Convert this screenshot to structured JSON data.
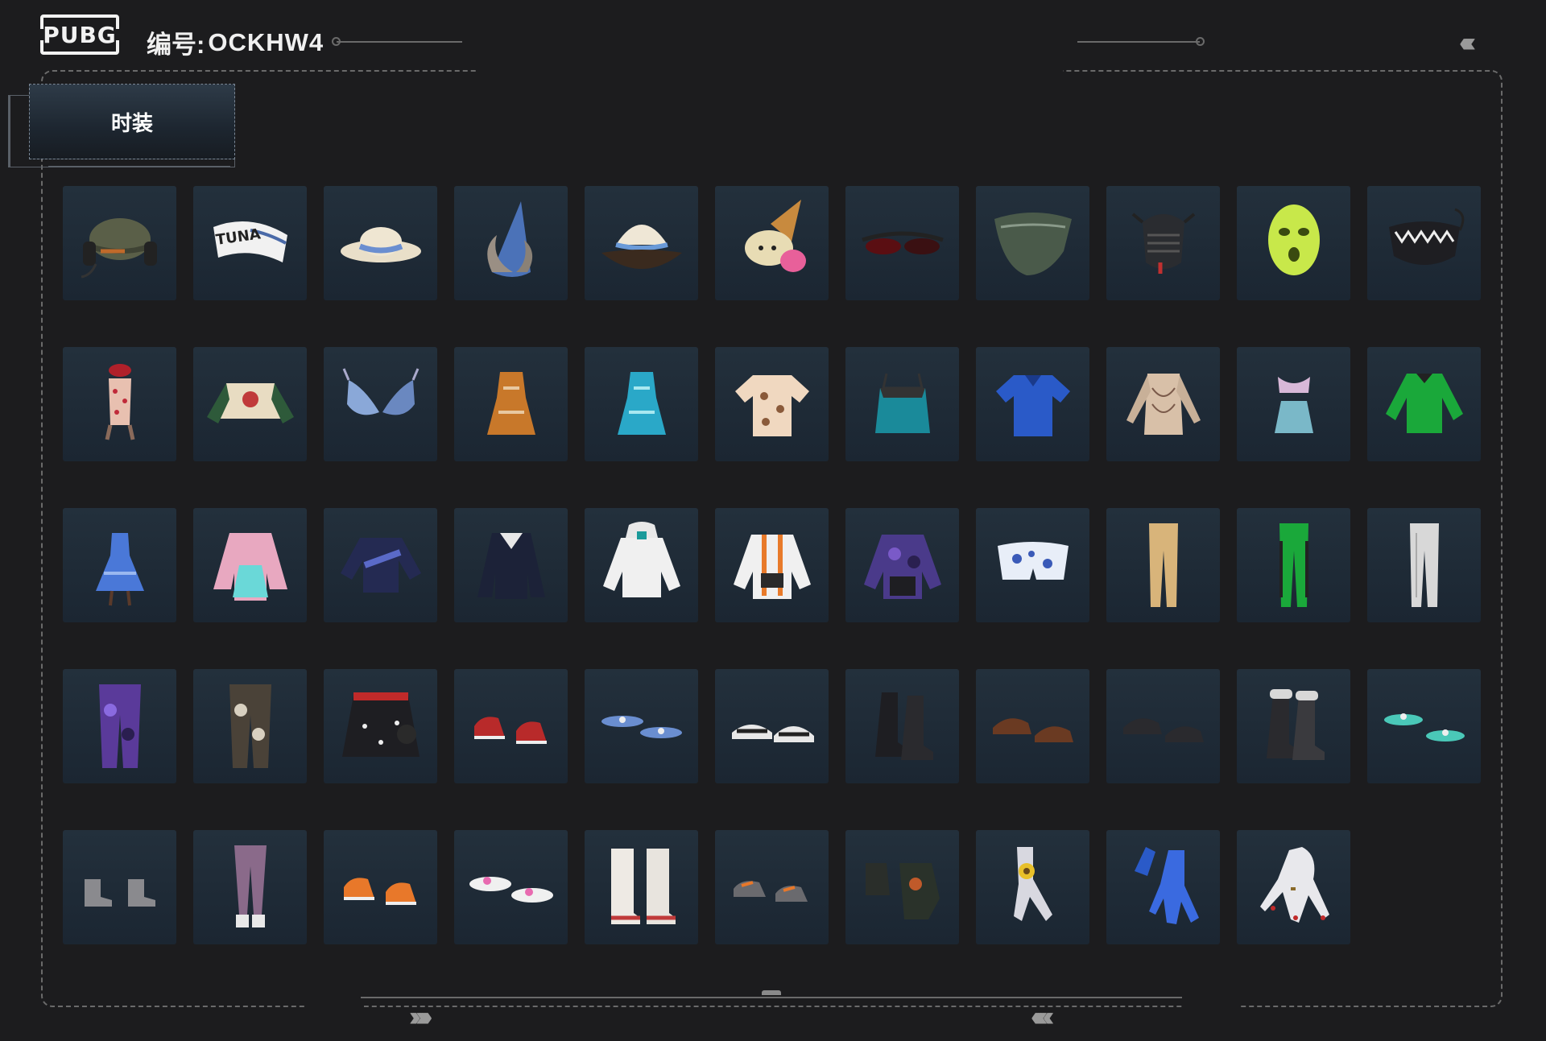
{
  "header": {
    "logo_text": "PUBG",
    "account_label": "编号:",
    "account_id": "OCKHW4"
  },
  "tabs": [
    {
      "label": "时装",
      "selected": true
    }
  ],
  "items": [
    {
      "icon": "headset-cap-icon",
      "name": "Cap with headset"
    },
    {
      "icon": "tuna-headband-icon",
      "name": "TUNA"
    },
    {
      "icon": "sun-hat-icon",
      "name": "Sun hat"
    },
    {
      "icon": "party-hat-icon",
      "name": "Party hat"
    },
    {
      "icon": "bucket-hat-icon",
      "name": "Bucket hat"
    },
    {
      "icon": "ice-cream-hat-icon",
      "name": "Ice cream hat"
    },
    {
      "icon": "sunglasses-icon",
      "name": "Sunglasses"
    },
    {
      "icon": "bandana-mask-icon",
      "name": "Bandana mask"
    },
    {
      "icon": "tactical-mask-icon",
      "name": "Tactical mask"
    },
    {
      "icon": "balaclava-icon",
      "name": "Balaclava"
    },
    {
      "icon": "shark-mask-icon",
      "name": "Shark mask"
    },
    {
      "icon": "floral-swimsuit-icon",
      "name": "Swimsuit"
    },
    {
      "icon": "crop-sweater-icon",
      "name": "Crop sweater"
    },
    {
      "icon": "bikini-top-icon",
      "name": "Bikini top"
    },
    {
      "icon": "orange-dress-icon",
      "name": "Orange dress"
    },
    {
      "icon": "cyan-dress-icon",
      "name": "Cyan dress"
    },
    {
      "icon": "dog-shirt-icon",
      "name": "Printed shirt"
    },
    {
      "icon": "lace-camisole-icon",
      "name": "Camisole"
    },
    {
      "icon": "security-polo-icon",
      "name": "Security polo"
    },
    {
      "icon": "tattoo-top-icon",
      "name": "Tattoo top"
    },
    {
      "icon": "mermaid-outfit-icon",
      "name": "Mermaid outfit"
    },
    {
      "icon": "green-jersey-icon",
      "name": "Green jersey"
    },
    {
      "icon": "blue-gradient-dress-icon",
      "name": "Blue dress"
    },
    {
      "icon": "pink-fur-jacket-icon",
      "name": "Pink fur jacket"
    },
    {
      "icon": "navy-sweatshirt-icon",
      "name": "Navy sweatshirt"
    },
    {
      "icon": "navy-coat-icon",
      "name": "Navy coat"
    },
    {
      "icon": "white-hoodie-icon",
      "name": "White hoodie"
    },
    {
      "icon": "orange-white-jacket-icon",
      "name": "Orange jacket"
    },
    {
      "icon": "purple-camo-jacket-icon",
      "name": "Purple jacket"
    },
    {
      "icon": "floral-shorts-icon",
      "name": "Floral shorts"
    },
    {
      "icon": "khaki-pants-icon",
      "name": "Khaki pants"
    },
    {
      "icon": "green-pants-icon",
      "name": "Green pants"
    },
    {
      "icon": "white-jeans-icon",
      "name": "White jeans"
    },
    {
      "icon": "purple-camo-pants-icon",
      "name": "Purple camo pants"
    },
    {
      "icon": "camo-cargo-pants-icon",
      "name": "Camo pants"
    },
    {
      "icon": "polka-skirt-icon",
      "name": "Polka dot skirt"
    },
    {
      "icon": "red-sneakers-icon",
      "name": "Red sneakers"
    },
    {
      "icon": "blue-slippers-icon",
      "name": "Blue slippers"
    },
    {
      "icon": "sandals-icon",
      "name": "Sandals"
    },
    {
      "icon": "black-boots-icon",
      "name": "Black boots"
    },
    {
      "icon": "brown-shoes-icon",
      "name": "Brown shoes"
    },
    {
      "icon": "black-shoes-icon",
      "name": "Black shoes"
    },
    {
      "icon": "fur-boots-icon",
      "name": "Fur boots"
    },
    {
      "icon": "mint-flip-flops-icon",
      "name": "Flip flops"
    },
    {
      "icon": "grey-ankle-boots-icon",
      "name": "Ankle boots"
    },
    {
      "icon": "pink-stockings-icon",
      "name": "Stockings"
    },
    {
      "icon": "orange-sneakers-icon",
      "name": "Orange sneakers"
    },
    {
      "icon": "pink-flats-icon",
      "name": "Pink flats"
    },
    {
      "icon": "white-fur-boots-icon",
      "name": "White fur boots"
    },
    {
      "icon": "grey-orange-sneakers-icon",
      "name": "Grey sneakers"
    },
    {
      "icon": "tactical-gloves-icon",
      "name": "Gloves"
    },
    {
      "icon": "sunflower-hand-icon",
      "name": "Sunflower hand"
    },
    {
      "icon": "blue-gloves-icon",
      "name": "Blue gloves"
    },
    {
      "icon": "red-nail-hand-icon",
      "name": "Hand with rings"
    }
  ],
  "colors": {
    "background": "#1c1c1e",
    "card": "#23303c",
    "frame": "#6a6a6a"
  }
}
